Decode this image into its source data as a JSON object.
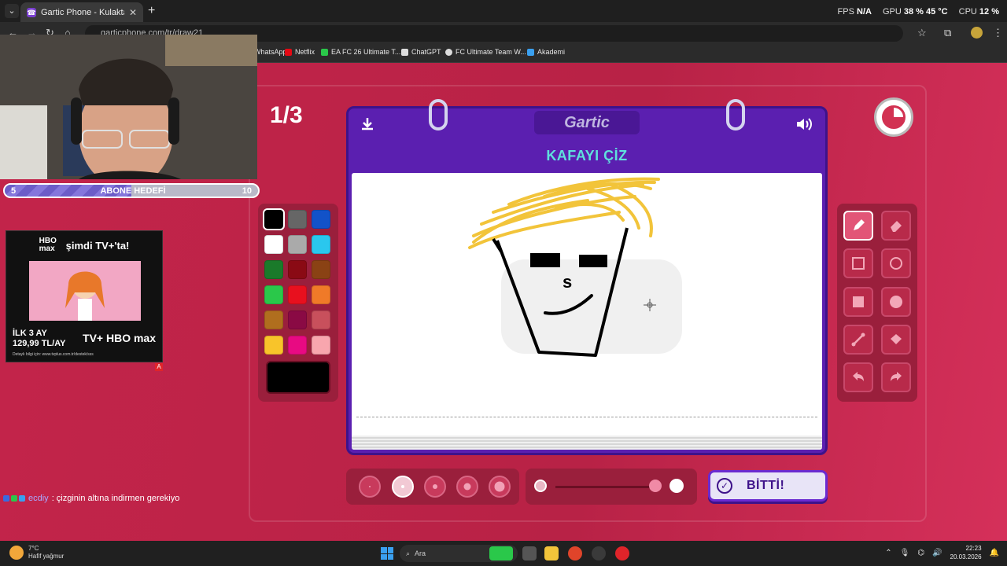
{
  "browser": {
    "tab_title": "Gartic Phone - Kulaktan Kulağa",
    "url": "garticphone.com/tr/draw21",
    "bookmarks": [
      "WhatsApp",
      "Netflix",
      "EA FC 26 Ultimate T...",
      "ChatGPT",
      "FC Ultimate Team W...",
      "Akademi"
    ],
    "stats": {
      "fps_label": "FPS",
      "fps_value": "N/A",
      "gpu_label": "GPU",
      "gpu_value": "38 % 45 °C",
      "cpu_label": "CPU",
      "cpu_value": "12 %"
    }
  },
  "game": {
    "round": "1/3",
    "logo": "Gartic",
    "task": "KAFAYI ÇİZ",
    "done_label": "BİTTİ!",
    "timer_remaining_fraction": 0.75,
    "opacity_level": 0.95,
    "selected_brush_size_index": 1,
    "selected_tool": "pencil",
    "palette": [
      "#000000",
      "#666666",
      "#1252c8",
      "#ffffff",
      "#aaaaaa",
      "#2ac7ee",
      "#1a7a2a",
      "#8a0a14",
      "#8a4214",
      "#2ac84a",
      "#e8101e",
      "#f07a28",
      "#b06e1e",
      "#8a0a44",
      "#c8505c",
      "#f8c42a",
      "#e80a82",
      "#f8a6ae"
    ],
    "selected_color": "#000000"
  },
  "stream": {
    "goal_start": "5",
    "goal_label": "ABONE HEDEFİ",
    "goal_end": "10",
    "goal_progress": 0.5,
    "chat_user": "ecdiy",
    "chat_message": ": çizginin altına indirmen gerekiyo"
  },
  "ad": {
    "brand_top": "HBO max",
    "headline": "şimdi TV+'ta!",
    "offer_line1": "İLK 3 AY",
    "offer_line2": "129,99 TL/AY",
    "brand_bottom": "TV+ HBO max",
    "detail": "Detaylı bilgi için: www.tvplus.com.tr/destek/sss"
  },
  "taskbar": {
    "temperature": "7°C",
    "weather": "Hafif yağmur",
    "search_placeholder": "Ara",
    "time": "22:23",
    "date": "20.03.2026"
  }
}
